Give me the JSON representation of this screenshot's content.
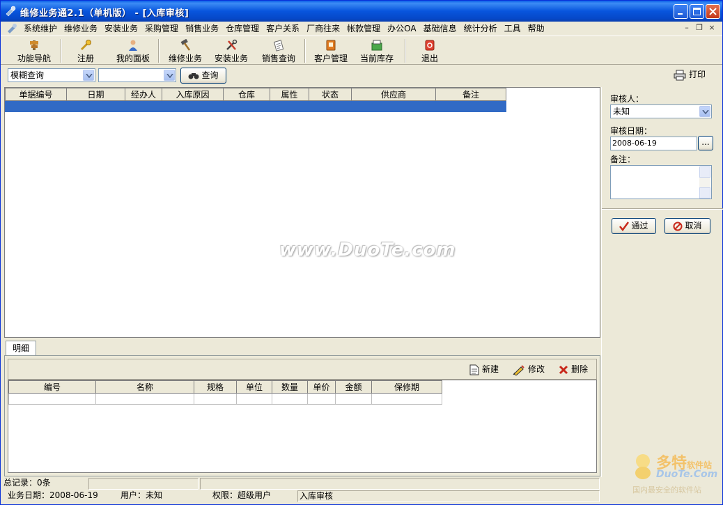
{
  "window": {
    "title": "维修业务通2.1（单机版） - [入库审核]"
  },
  "menubar": {
    "items": [
      "系统维护",
      "维修业务",
      "安装业务",
      "采购管理",
      "销售业务",
      "仓库管理",
      "客户关系",
      "厂商往来",
      "帐款管理",
      "办公OA",
      "基础信息",
      "统计分析",
      "工具",
      "帮助"
    ]
  },
  "toolbar": {
    "items": [
      {
        "label": "功能导航",
        "icon": "compass-icon"
      },
      {
        "label": "注册",
        "icon": "key-icon"
      },
      {
        "label": "我的面板",
        "icon": "user-icon"
      },
      {
        "label": "维修业务",
        "icon": "hammer-icon"
      },
      {
        "label": "安装业务",
        "icon": "tools-icon"
      },
      {
        "label": "销售查询",
        "icon": "document-icon"
      },
      {
        "label": "客户管理",
        "icon": "contacts-icon"
      },
      {
        "label": "当前库存",
        "icon": "inventory-icon"
      },
      {
        "label": "退出",
        "icon": "exit-icon"
      }
    ]
  },
  "query": {
    "mode_value": "模糊查询",
    "field_value": "",
    "search_label": "查询",
    "print_label": "打印"
  },
  "main_grid": {
    "columns": [
      "单据编号",
      "日期",
      "经办人",
      "入库原因",
      "仓库",
      "属性",
      "状态",
      "供应商",
      "备注"
    ]
  },
  "watermark": "www.DuoTe.com",
  "detail": {
    "tab_label": "明细",
    "new_label": "新建",
    "edit_label": "修改",
    "delete_label": "删除",
    "columns": [
      "编号",
      "名称",
      "规格",
      "单位",
      "数量",
      "单价",
      "金额",
      "保修期"
    ]
  },
  "review": {
    "reviewer_label": "审核人：",
    "reviewer_value": "未知",
    "date_label": "审核日期：",
    "date_value": "2008-06-19",
    "ellipsis_label": "...",
    "note_label": "备注：",
    "approve_label": "通过",
    "cancel_label": "取消"
  },
  "status": {
    "total_records": "总记录：0条",
    "business_date": "业务日期：2008-06-19",
    "user": "用户：未知",
    "permission": "权限：超级用户",
    "module": "入库审核"
  },
  "logo": {
    "brand": "多特",
    "brand_small": "软件站",
    "domain": "DuoTe.Com",
    "slogan": "国内最安全的软件站"
  },
  "colors": {
    "title_bar": "#0a5fe8",
    "selected_row": "#316ac5",
    "window_bg": "#ece9d8"
  }
}
